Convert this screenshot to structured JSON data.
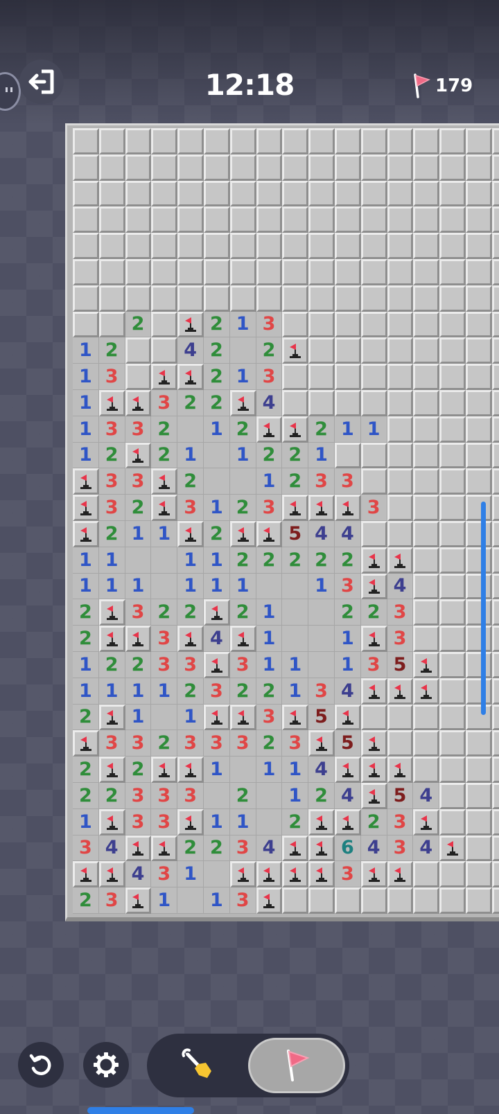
{
  "header": {
    "timer": "12:18",
    "flags_remaining": "179"
  },
  "icons": {
    "exit": "exit-icon",
    "flag": "flag-icon",
    "restart": "restart-icon",
    "settings": "gear-icon",
    "dig": "shovel-icon"
  },
  "colors": {
    "n1": "#2f55c6",
    "n2": "#2f8d3a",
    "n3": "#e04646",
    "n4": "#3d3f8f",
    "n5": "#7d1d1d",
    "n6": "#1d8080",
    "flag": "#e8344a",
    "accent": "#2f7fe6"
  },
  "board": {
    "legend": "#=covered, .=open empty, F=flag, 1-8=number",
    "rows": [
      "#################",
      "#################",
      "#################",
      "#################",
      "#################",
      "#################",
      "#################",
      "##2#F213#########",
      "12##42.2F########",
      "13#FF213#########",
      "1FF322F4#########",
      "1332.12FF211#####",
      "12F21.1221######",
      "F33F2..1233#####",
      "F32F3123FFF3#####",
      "F211F2FF544#####",
      "11..1122222FF####",
      "111.111..13F4####",
      "2F322F21..223####",
      "2FF3F4F1..1F3####",
      "12233F311.135F####",
      "11112322134FFF###",
      "2F1.1FF3F5F######",
      "F33233323F5F#####",
      "2F2FF1.114FFF####",
      "22333 2.124F54####",
      "1F33F11 2FF23F####",
      "34FF2234FF6434F####",
      "FF431.FFFF3FF#####",
      "23F1.13F#########"
    ]
  }
}
